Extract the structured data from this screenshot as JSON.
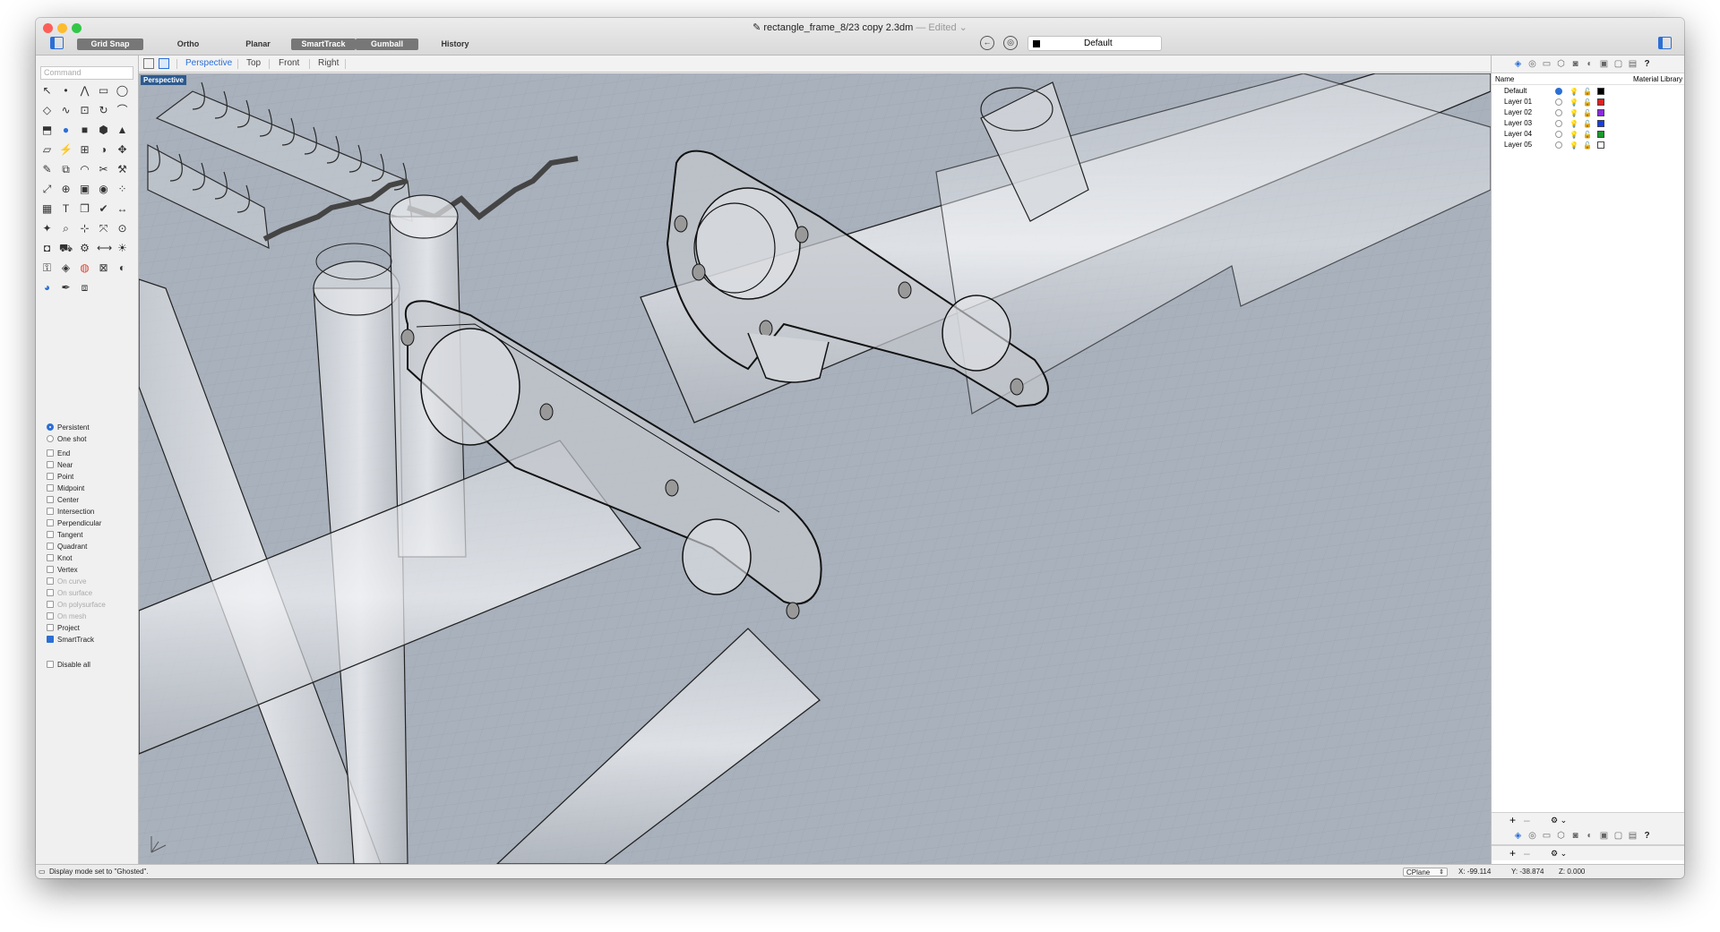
{
  "window": {
    "title": "rectangle_frame_8/23 copy 2.3dm",
    "title_suffix": "— Edited ⌄",
    "traffic_colors": [
      "#fc5f57",
      "#fdbc2e",
      "#33c748"
    ]
  },
  "toolbar": {
    "toggles": [
      {
        "label": "Grid Snap",
        "on": true
      },
      {
        "label": "Ortho",
        "on": false
      },
      {
        "label": "Planar",
        "on": false
      },
      {
        "label": "SmartTrack",
        "on": true
      },
      {
        "label": "Gumball",
        "on": true
      },
      {
        "label": "History",
        "on": false
      }
    ],
    "layer_selector": "Default"
  },
  "viewport_tabs": [
    "Perspective",
    "Top",
    "Front",
    "Right"
  ],
  "active_viewport": "Perspective",
  "viewport_label": "Perspective",
  "command_placeholder": "Command",
  "tool_icons": [
    "select-arrow-icon",
    "point-icon",
    "polyline-icon",
    "rectangle-icon",
    "circle-icon",
    "surface-icon",
    "curve-icon",
    "trim-box-icon",
    "rotate-icon",
    "fillet-icon",
    "extrude-icon",
    "sphere-icon",
    "cube-icon",
    "cylinder-icon",
    "cone-icon",
    "plane-icon",
    "lightning-icon",
    "array-icon",
    "boolean-icon",
    "move-icon",
    "paint-icon",
    "group-icon",
    "arc-icon",
    "cut-icon",
    "hammer-icon",
    "transform-icon",
    "join-icon",
    "box-icon",
    "ball-icon",
    "dots-icon",
    "grid-icon",
    "text-icon",
    "copy-icon",
    "check-icon",
    "dimension-icon",
    "render-icon",
    "zoom-icon",
    "snap-icon",
    "zoom-extents-icon",
    "lasso-icon",
    "camera-icon",
    "car-icon",
    "gear-icon",
    "dimension2-icon",
    "light-icon",
    "lock-icon",
    "material-icon",
    "color-wheel-icon",
    "mesh-icon",
    "display-icon",
    "globe-icon",
    "pen-icon",
    "group2-icon"
  ],
  "osnap": {
    "modes": [
      {
        "label": "Persistent",
        "type": "radio",
        "checked": true
      },
      {
        "label": "One shot",
        "type": "radio",
        "checked": false
      }
    ],
    "snaps": [
      {
        "label": "End",
        "checked": false,
        "disabled": false
      },
      {
        "label": "Near",
        "checked": false,
        "disabled": false
      },
      {
        "label": "Point",
        "checked": false,
        "disabled": false
      },
      {
        "label": "Midpoint",
        "checked": false,
        "disabled": false
      },
      {
        "label": "Center",
        "checked": false,
        "disabled": false
      },
      {
        "label": "Intersection",
        "checked": false,
        "disabled": false
      },
      {
        "label": "Perpendicular",
        "checked": false,
        "disabled": false
      },
      {
        "label": "Tangent",
        "checked": false,
        "disabled": false
      },
      {
        "label": "Quadrant",
        "checked": false,
        "disabled": false
      },
      {
        "label": "Knot",
        "checked": false,
        "disabled": false
      },
      {
        "label": "Vertex",
        "checked": false,
        "disabled": false
      },
      {
        "label": "On curve",
        "checked": false,
        "disabled": true
      },
      {
        "label": "On surface",
        "checked": false,
        "disabled": true
      },
      {
        "label": "On polysurface",
        "checked": false,
        "disabled": true
      },
      {
        "label": "On mesh",
        "checked": false,
        "disabled": true
      },
      {
        "label": "Project",
        "checked": false,
        "disabled": false
      },
      {
        "label": "SmartTrack",
        "checked": true,
        "disabled": false
      }
    ],
    "disable_all": {
      "label": "Disable all",
      "checked": false
    }
  },
  "layers_panel": {
    "col_name": "Name",
    "col_material": "Material Library",
    "layers": [
      {
        "name": "Default",
        "current": true,
        "color": "#000000"
      },
      {
        "name": "Layer 01",
        "current": false,
        "color": "#e02020"
      },
      {
        "name": "Layer 02",
        "current": false,
        "color": "#8a2be2"
      },
      {
        "name": "Layer 03",
        "current": false,
        "color": "#1a3de0"
      },
      {
        "name": "Layer 04",
        "current": false,
        "color": "#1a9a2a"
      },
      {
        "name": "Layer 05",
        "current": false,
        "color": "#ffffff"
      }
    ],
    "add_label": "+",
    "remove_label": "–",
    "gear_label": "⚙ ⌄"
  },
  "statusbar": {
    "message": "Display mode set to \"Ghosted\".",
    "cplane": "CPlane",
    "x": "X: -99.114",
    "y": "Y: -38.874",
    "z": "Z: 0.000"
  },
  "colors": {
    "accent": "#2b6fd6",
    "viewport_bg": "#a9b1bc",
    "grid_line": "#9aa3af"
  }
}
